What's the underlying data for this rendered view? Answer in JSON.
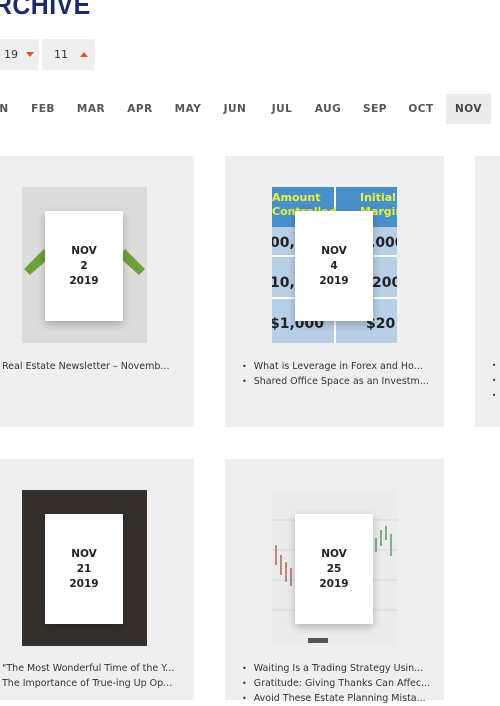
{
  "header": {
    "title": "RCHIVE"
  },
  "filters": {
    "year_value": "19",
    "month_value": "11"
  },
  "months": [
    "N",
    "FEB",
    "MAR",
    "APR",
    "MAY",
    "JUN",
    "JUL",
    "AUG",
    "SEP",
    "OCT",
    "NOV"
  ],
  "active_month": "NOV",
  "cards": [
    {
      "date": {
        "month": "NOV",
        "day": "2",
        "year": "2019"
      },
      "posts": [
        "Real Estate Newsletter – Novemb..."
      ]
    },
    {
      "date": {
        "month": "NOV",
        "day": "4",
        "year": "2019"
      },
      "thumb_text": {
        "h1": "Amount",
        "h1b": "Controlled",
        "h2": "Initial",
        "h2b": "Margin",
        "r1a": "00,",
        "r1b": ",000",
        "r2a": "10,",
        "r2b": "200",
        "r3a": "$1,000",
        "r3b": "$20"
      },
      "posts": [
        "What is Leverage in Forex and Ho...",
        "Shared Office Space as an Investm..."
      ]
    },
    {
      "date": {
        "month": "NOV",
        "day": "21",
        "year": "2019"
      },
      "posts": [
        "\"The Most Wonderful Time of the Y...",
        "The Importance of True-ing Up Op..."
      ]
    },
    {
      "date": {
        "month": "NOV",
        "day": "25",
        "year": "2019"
      },
      "posts": [
        "Waiting Is a Trading Strategy Usin...",
        "Gratitude: Giving Thanks Can Affec...",
        "Avoid These Estate Planning Mista..."
      ]
    }
  ],
  "colors": {
    "brand": "#1a2a6c",
    "accent": "#e4542b",
    "card_bg": "#f0efef"
  }
}
